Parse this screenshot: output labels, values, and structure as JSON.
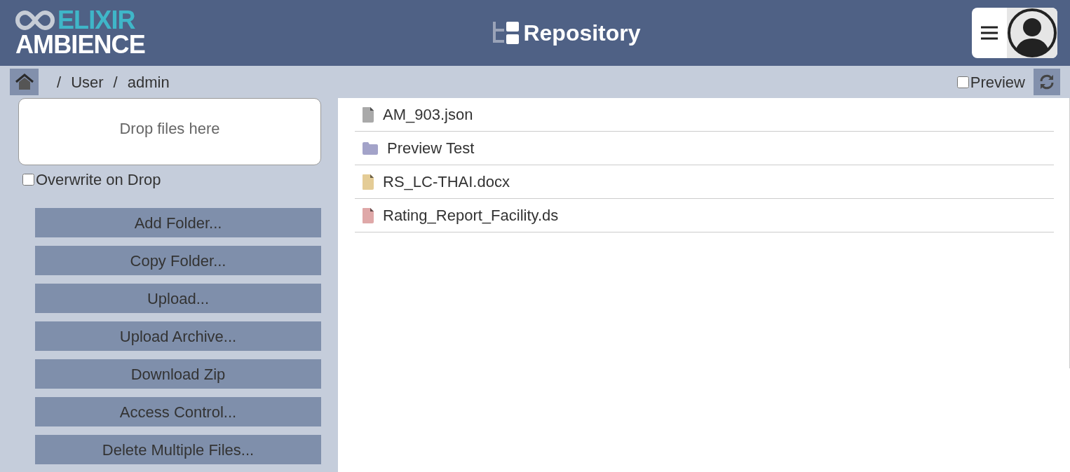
{
  "header": {
    "logo_top": "ELIXIR",
    "logo_bottom": "AMBIENCE",
    "title": "Repository"
  },
  "breadcrumb": {
    "items": [
      {
        "separator": "/",
        "label": "User"
      },
      {
        "separator": "/",
        "label": "admin"
      }
    ]
  },
  "preview": {
    "label": "Preview",
    "checked": false
  },
  "drop_zone": {
    "label": "Drop files here"
  },
  "overwrite": {
    "label": "Overwrite on Drop",
    "checked": false
  },
  "actions": [
    "Add Folder...",
    "Copy Folder...",
    "Upload...",
    "Upload Archive...",
    "Download Zip",
    "Access Control...",
    "Delete Multiple Files..."
  ],
  "files": [
    {
      "name": "AM_903.json",
      "kind": "file",
      "color": "#a9a9a9"
    },
    {
      "name": "Preview Test",
      "kind": "folder",
      "color": "#a3a3c9"
    },
    {
      "name": "RS_LC-THAI.docx",
      "kind": "file",
      "color": "#e4cc96"
    },
    {
      "name": "Rating_Report_Facility.ds",
      "kind": "file",
      "color": "#dfa8a8"
    }
  ]
}
